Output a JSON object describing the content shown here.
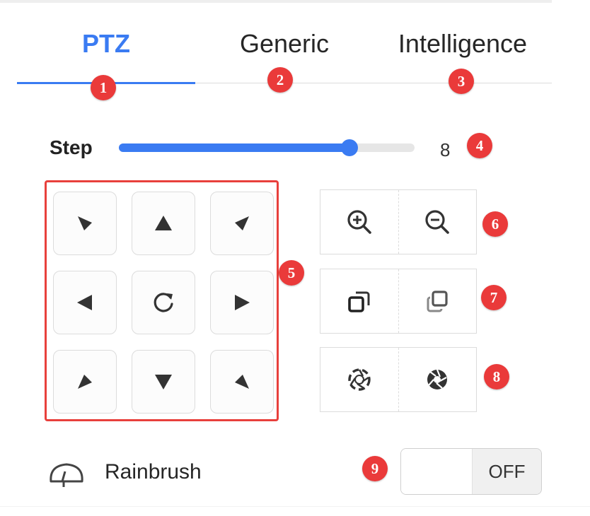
{
  "tabs": [
    {
      "label": "PTZ",
      "active": true
    },
    {
      "label": "Generic",
      "active": false
    },
    {
      "label": "Intelligence",
      "active": false
    }
  ],
  "step": {
    "label": "Step",
    "value": "8",
    "fraction": 0.78
  },
  "badges": [
    "1",
    "2",
    "3",
    "4",
    "5",
    "6",
    "7",
    "8",
    "9"
  ],
  "direction_pad": {
    "buttons": [
      {
        "name": "up-left",
        "icon": "arrow-up-left-icon"
      },
      {
        "name": "up",
        "icon": "arrow-up-icon"
      },
      {
        "name": "up-right",
        "icon": "arrow-up-right-icon"
      },
      {
        "name": "left",
        "icon": "arrow-left-icon"
      },
      {
        "name": "auto-rotate",
        "icon": "rotate-icon"
      },
      {
        "name": "right",
        "icon": "arrow-right-icon"
      },
      {
        "name": "down-left",
        "icon": "arrow-down-left-icon"
      },
      {
        "name": "down",
        "icon": "arrow-down-icon"
      },
      {
        "name": "down-right",
        "icon": "arrow-down-right-icon"
      }
    ]
  },
  "controls": {
    "zoom": [
      "zoom-in-icon",
      "zoom-out-icon"
    ],
    "focus": [
      "focus-near-icon",
      "focus-far-icon"
    ],
    "iris": [
      "iris-open-icon",
      "iris-close-icon"
    ]
  },
  "rainbrush": {
    "label": "Rainbrush",
    "icon": "wiper-icon",
    "toggle_text": "OFF",
    "state": false
  },
  "colors": {
    "accent": "#3a7bf2",
    "badge": "#ea3a3a",
    "highlight_border": "#e8403c"
  }
}
